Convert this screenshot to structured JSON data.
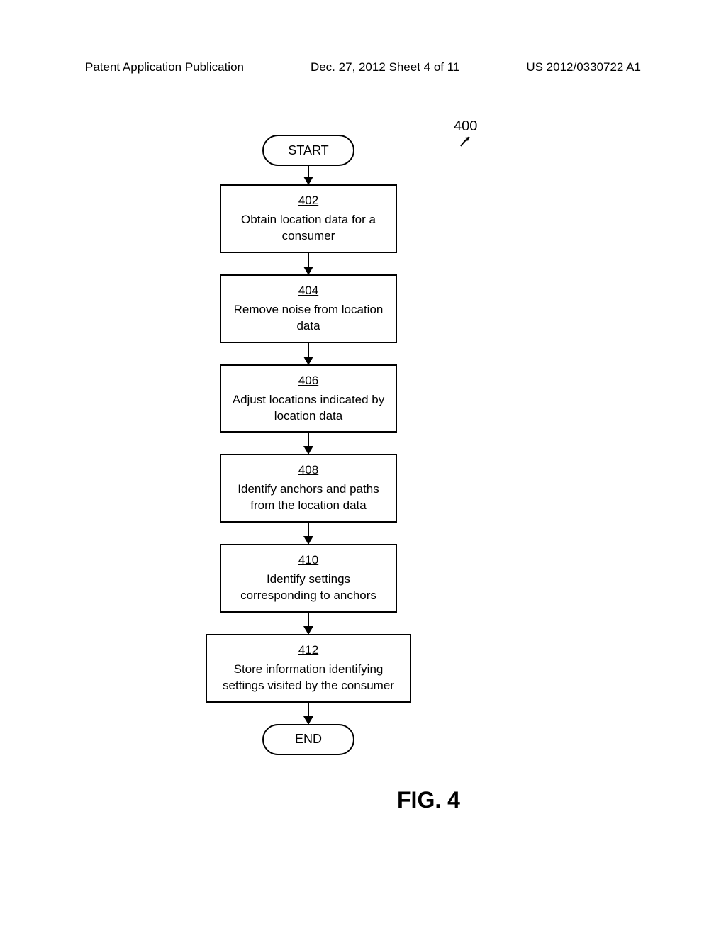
{
  "header": {
    "left": "Patent Application Publication",
    "center": "Dec. 27, 2012  Sheet 4 of 11",
    "right": "US 2012/0330722 A1"
  },
  "figure_ref": "400",
  "flowchart": {
    "start": "START",
    "end": "END",
    "steps": [
      {
        "num": "402",
        "text": "Obtain location data for a consumer"
      },
      {
        "num": "404",
        "text": "Remove noise from location data"
      },
      {
        "num": "406",
        "text": "Adjust locations indicated by location data"
      },
      {
        "num": "408",
        "text": "Identify anchors and paths from the location data"
      },
      {
        "num": "410",
        "text": "Identify settings corresponding to anchors"
      },
      {
        "num": "412",
        "text": "Store information identifying settings visited by the consumer"
      }
    ]
  },
  "figure_label": "FIG. 4"
}
